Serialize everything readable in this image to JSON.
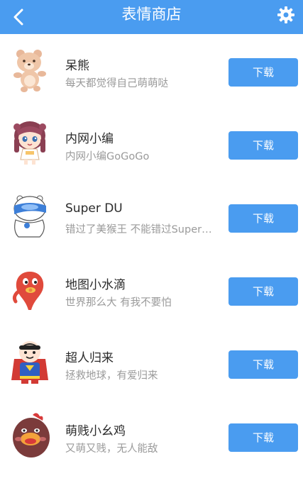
{
  "header": {
    "title": "表情商店",
    "back_icon": "chevron-left-icon",
    "settings_icon": "gear-icon",
    "bar_color": "#4a9cf0"
  },
  "stickers": [
    {
      "name": "呆熊",
      "desc": "每天都觉得自己萌萌哒",
      "button": "下载"
    },
    {
      "name": "内网小编",
      "desc": "内网小编GoGoGo",
      "button": "下载"
    },
    {
      "name": "Super DU",
      "desc": "错过了美猴王 不能错过Super…",
      "button": "下载"
    },
    {
      "name": "地图小水滴",
      "desc": "世界那么大 有我不要怕",
      "button": "下载"
    },
    {
      "name": "超人归来",
      "desc": "拯救地球，有爱归来",
      "button": "下载"
    },
    {
      "name": "萌贱小幺鸡",
      "desc": "又萌又贱，无人能敌",
      "button": "下载"
    }
  ],
  "colors": {
    "accent": "#4a9cf0",
    "title_text": "#2b2b2b",
    "desc_text": "#9a9a9a"
  }
}
